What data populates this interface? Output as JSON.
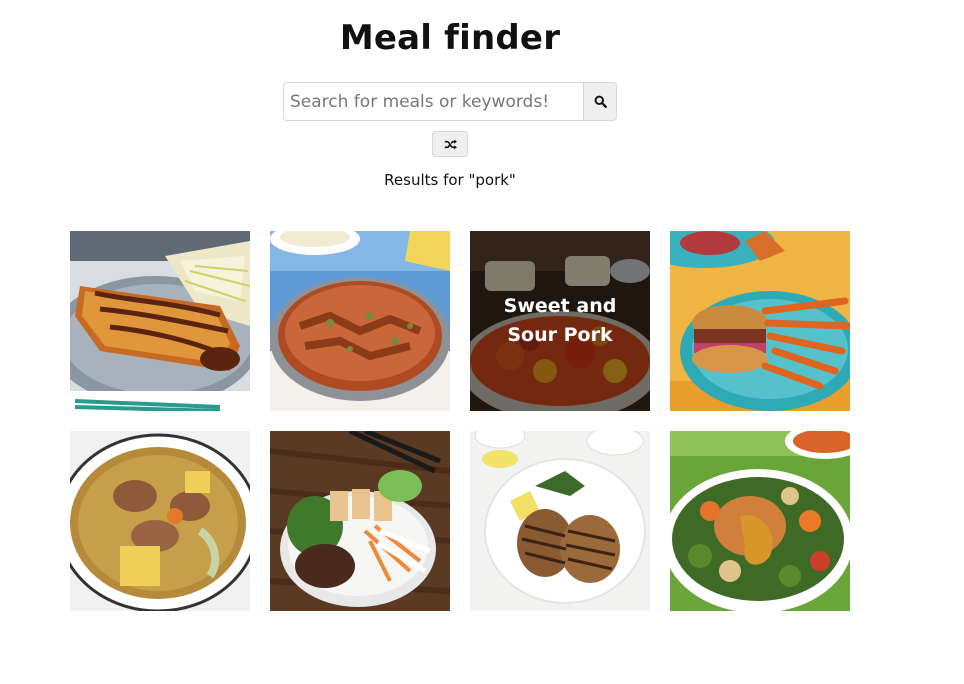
{
  "header": {
    "title": "Meal finder"
  },
  "search": {
    "placeholder": "Search for meals or keywords!",
    "value": "",
    "search_icon": "search-icon",
    "random_icon": "shuffle-icon"
  },
  "results": {
    "heading": "Results for \"pork\""
  },
  "meals": [
    {
      "name": "",
      "photo": "katsu-pork-cutlet-with-cabbage"
    },
    {
      "name": "",
      "photo": "pork-stew-in-pan"
    },
    {
      "name": "Sweet and Sour Pork",
      "photo": "sweet-and-sour-pork-plate",
      "hovered": true
    },
    {
      "name": "",
      "photo": "pulled-pork-burger-with-sweet-potato-fries"
    },
    {
      "name": "",
      "photo": "pork-and-potato-stew-bowl"
    },
    {
      "name": "",
      "photo": "vietnamese-pork-noodle-bowl"
    },
    {
      "name": "",
      "photo": "grilled-pork-chops-plate"
    },
    {
      "name": "",
      "photo": "pork-with-roasted-vegetables"
    }
  ],
  "colors": {
    "button_bg": "#efefef",
    "border": "#d8d8d8",
    "overlay": "rgba(0,0,0,0.45)"
  }
}
